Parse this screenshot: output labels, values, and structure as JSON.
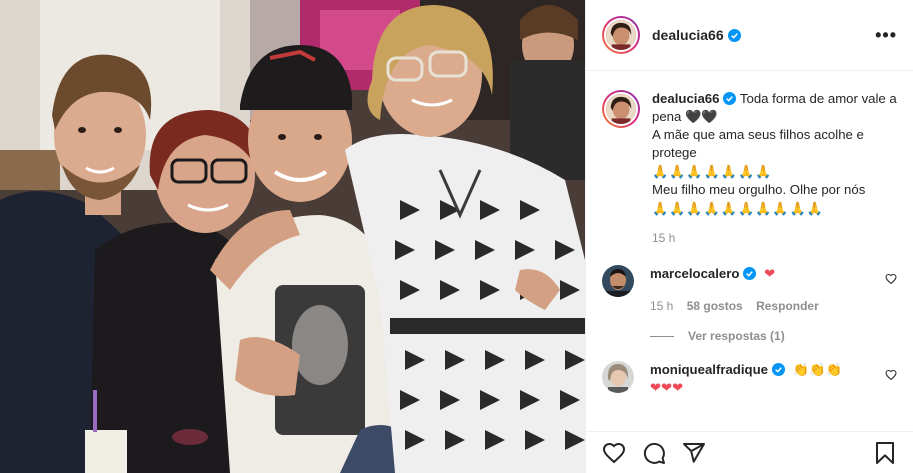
{
  "post": {
    "author": "dealucia66",
    "more_label": "•••"
  },
  "caption": {
    "username": "dealucia66",
    "lines": [
      "Toda forma de amor vale a pena 🖤🖤",
      "A mãe que ama seus filhos acolhe e protege",
      "Meu filho meu orgulho. Olhe por nós"
    ],
    "time": "15 h",
    "emoji": "🙏"
  },
  "comments": [
    {
      "username": "marcelocalero",
      "text": "❤",
      "time": "15 h",
      "likes": "58 gostos",
      "reply_label": "Responder",
      "view_replies": "Ver respostas (1)"
    },
    {
      "username": "moniquealfradique",
      "text": "👏👏👏",
      "text2": "❤❤❤"
    }
  ],
  "icons": {
    "like": "heart-icon",
    "comment": "comment-icon",
    "share": "share-icon",
    "save": "bookmark-icon",
    "verified": "verified-badge-icon",
    "more": "more-options-icon"
  },
  "colors": {
    "verified": "#0095f6",
    "heart": "#ed4956",
    "text_secondary": "#8e8e8e",
    "border": "#efefef"
  }
}
